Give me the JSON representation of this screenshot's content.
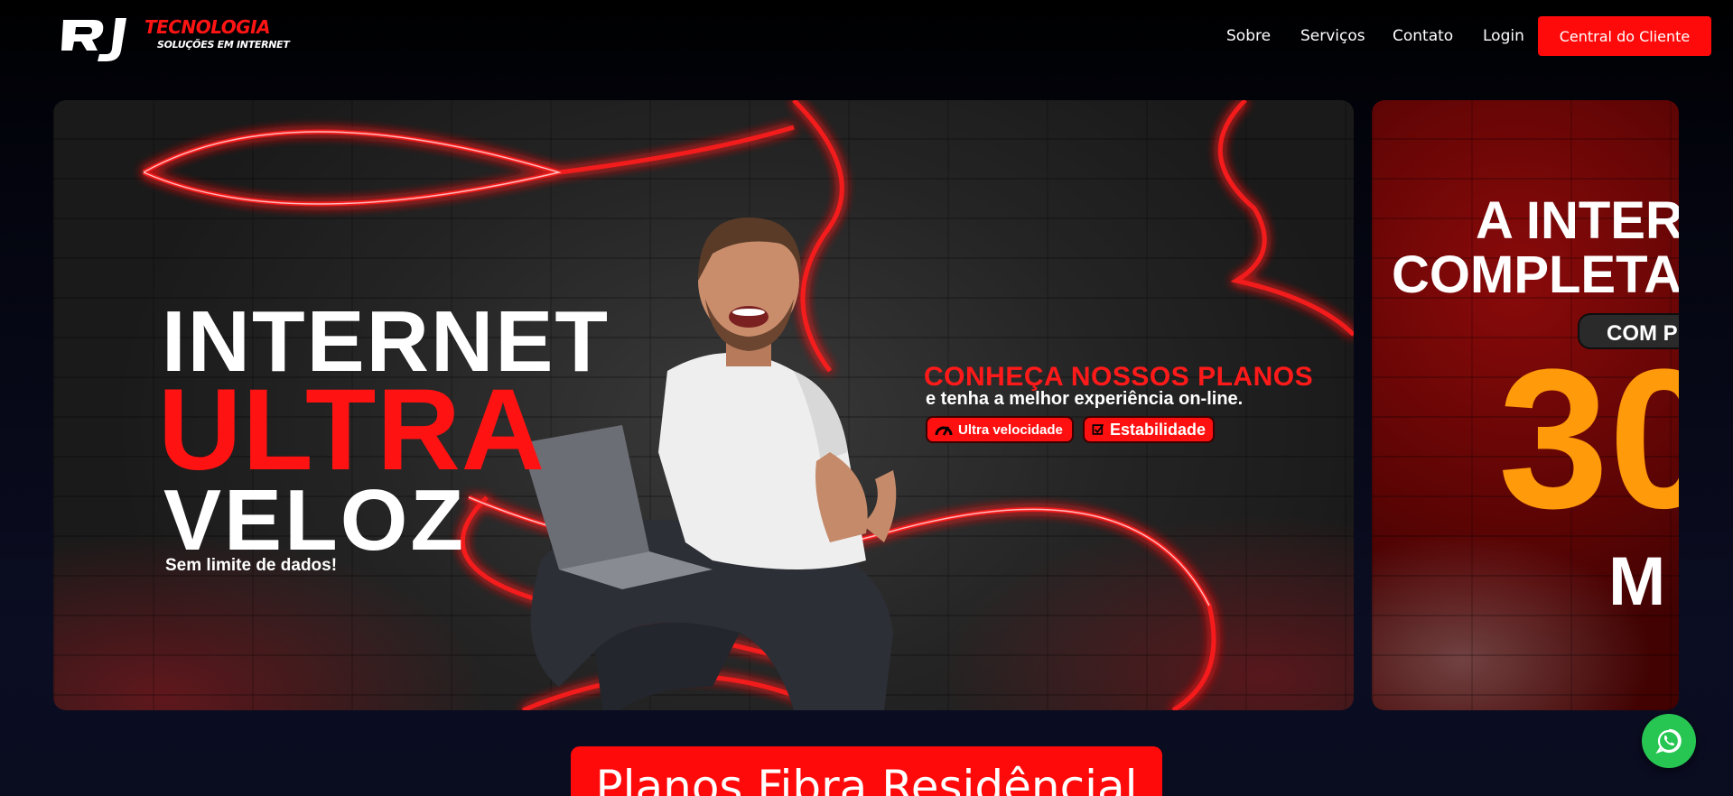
{
  "header": {
    "logo": {
      "mark": "RJ",
      "brand": "TECNOLOGIA",
      "tagline": "SOLUÇÕES EM INTERNET"
    },
    "nav": [
      {
        "label": "Sobre"
      },
      {
        "label": "Serviços"
      },
      {
        "label": "Contato"
      },
      {
        "label": "Login"
      }
    ],
    "cta_label": "Central do Cliente"
  },
  "carousel": {
    "slides": [
      {
        "line1": "INTERNET",
        "line2": "ULTRA",
        "line3": "VELOZ",
        "subtitle": "Sem limite de dados!",
        "plans_title": "CONHEÇA NOSSOS PLANOS",
        "plans_subtitle": "e tenha a melhor experiência on-line.",
        "badges": [
          {
            "label": "Ultra velocidade",
            "icon": "speedometer-icon"
          },
          {
            "label": "Estabilidade",
            "icon": "checkbox-icon"
          }
        ]
      },
      {
        "line1": "A INTER",
        "line2": "COMPLETA",
        "pill": "COM P",
        "big_number": "30",
        "unit": "M"
      }
    ]
  },
  "section": {
    "heading": "Planos Fibra Residêncial"
  },
  "floating": {
    "whatsapp_icon": "whatsapp-icon"
  },
  "colors": {
    "accent": "#ff0a0a",
    "background": "#000000",
    "whatsapp": "#27c653",
    "highlight_orange": "#ff9a0a"
  }
}
